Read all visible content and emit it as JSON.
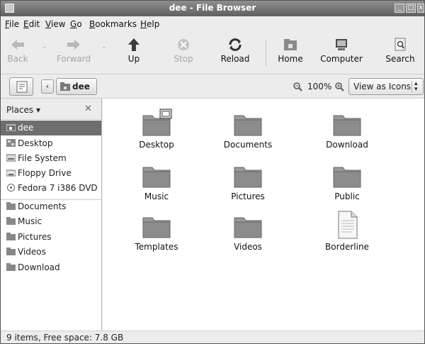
{
  "window": {
    "title": "dee - File Browser"
  },
  "menu": [
    {
      "label": "File",
      "accel": "F",
      "rest": "ile"
    },
    {
      "label": "Edit",
      "accel": "E",
      "rest": "dit"
    },
    {
      "label": "View",
      "accel": "V",
      "rest": "iew"
    },
    {
      "label": "Go",
      "accel": "G",
      "rest": "o"
    },
    {
      "label": "Bookmarks",
      "accel": "B",
      "rest": "ookmarks"
    },
    {
      "label": "Help",
      "accel": "H",
      "rest": "elp"
    }
  ],
  "toolbar": {
    "back": "Back",
    "forward": "Forward",
    "up": "Up",
    "stop": "Stop",
    "reload": "Reload",
    "home": "Home",
    "computer": "Computer",
    "search": "Search"
  },
  "location": {
    "path_button": "dee",
    "zoom": "100%",
    "view_mode": "View as Icons"
  },
  "sidebar": {
    "header": "Places",
    "items": [
      {
        "label": "dee",
        "icon": "home-folder-icon",
        "selected": true
      },
      {
        "label": "Desktop",
        "icon": "desktop-icon"
      },
      {
        "label": "File System",
        "icon": "drive-icon"
      },
      {
        "label": "Floppy Drive",
        "icon": "floppy-icon"
      },
      {
        "label": "Fedora 7 i386 DVD",
        "icon": "disc-icon"
      },
      {
        "label": "Documents",
        "icon": "folder-icon"
      },
      {
        "label": "Music",
        "icon": "folder-icon"
      },
      {
        "label": "Pictures",
        "icon": "folder-icon"
      },
      {
        "label": "Videos",
        "icon": "folder-icon"
      },
      {
        "label": "Download",
        "icon": "folder-icon"
      }
    ]
  },
  "files": [
    {
      "name": "Desktop",
      "icon": "desktop-folder-icon"
    },
    {
      "name": "Documents",
      "icon": "folder-icon"
    },
    {
      "name": "Download",
      "icon": "folder-icon"
    },
    {
      "name": "Music",
      "icon": "folder-icon"
    },
    {
      "name": "Pictures",
      "icon": "folder-icon"
    },
    {
      "name": "Public",
      "icon": "folder-icon"
    },
    {
      "name": "Templates",
      "icon": "folder-icon"
    },
    {
      "name": "Videos",
      "icon": "folder-icon"
    },
    {
      "name": "Borderline",
      "icon": "document-icon"
    }
  ],
  "status": "9 items, Free space: 7.8 GB",
  "colors": {
    "selected_row": "#6e6e6e",
    "titlebar": "#6f6f6f"
  }
}
